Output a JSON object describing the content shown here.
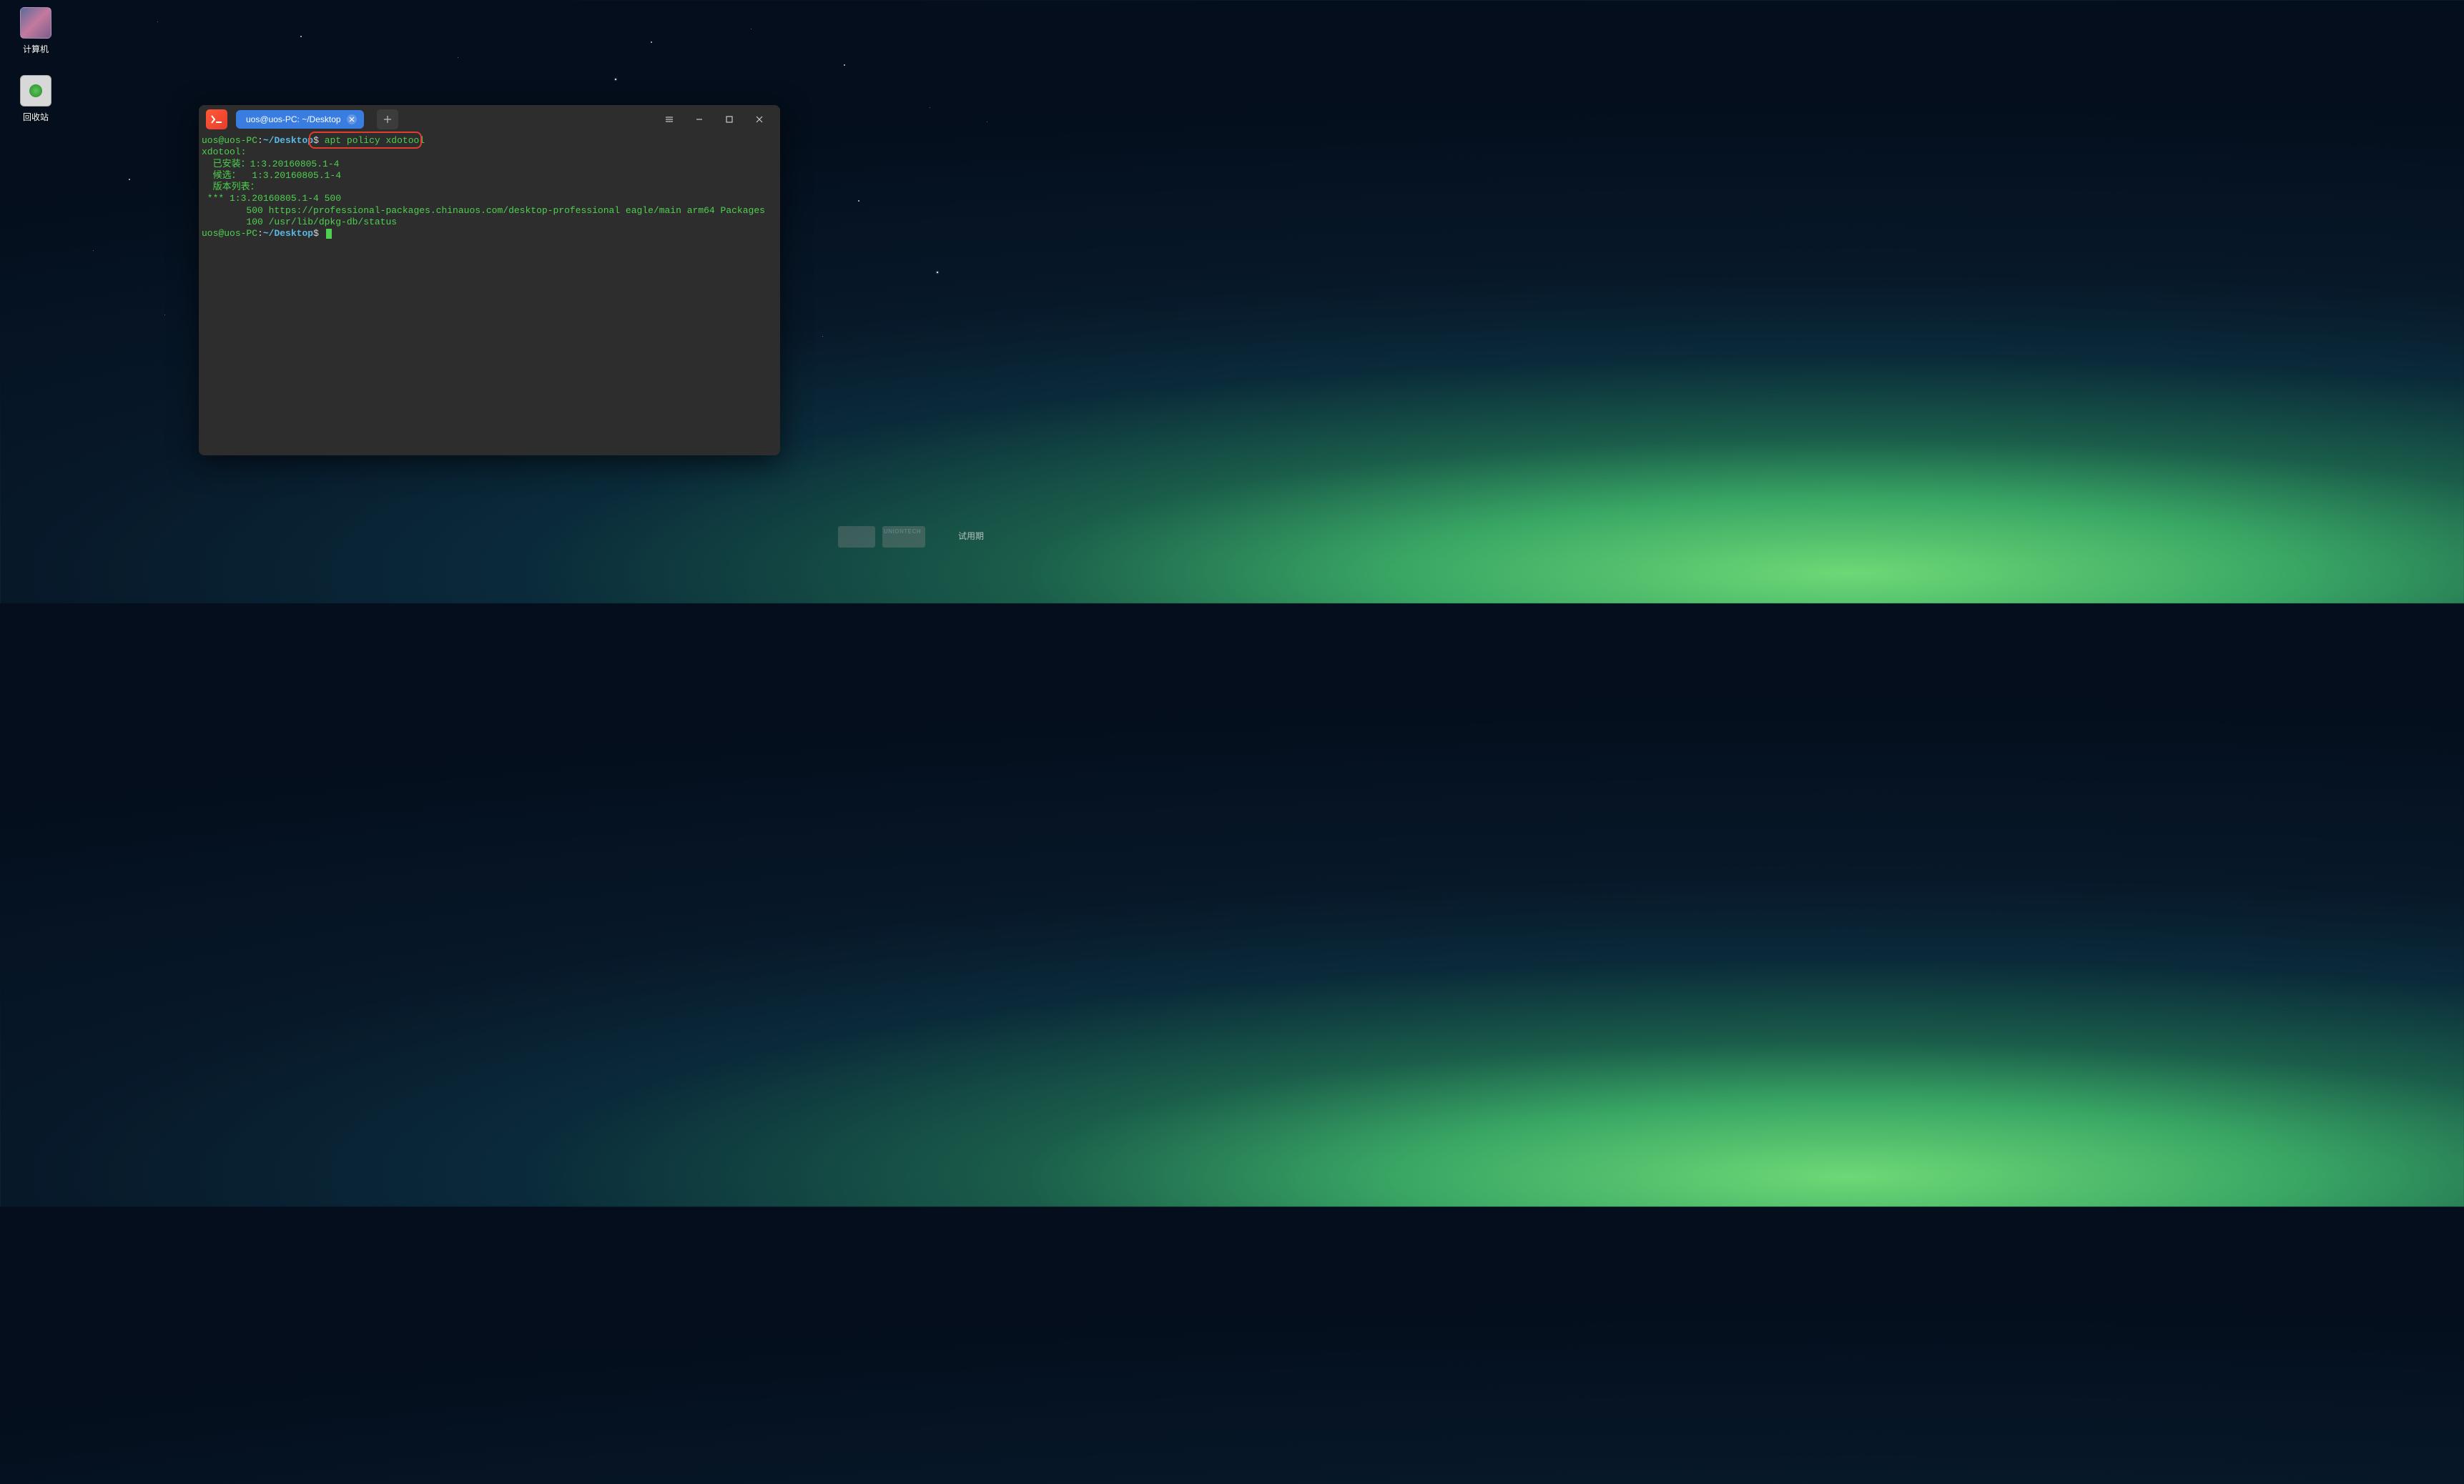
{
  "desktop": {
    "icons": [
      {
        "name": "computer",
        "label": "计算机"
      },
      {
        "name": "trash",
        "label": "回收站"
      }
    ]
  },
  "terminal": {
    "tab_title": "uos@uos-PC: ~/Desktop",
    "prompt": {
      "user": "uos",
      "at": "@",
      "host": "uos-PC",
      "colon": ":",
      "path": "~/Desktop",
      "dollar": "$"
    },
    "command": "apt policy xdotool",
    "output_lines": [
      "xdotool:",
      "  已安装：1:3.20160805.1-4",
      "  候选：  1:3.20160805.1-4",
      "  版本列表：",
      " *** 1:3.20160805.1-4 500",
      "        500 https://professional-packages.chinauos.com/desktop-professional eagle/main arm64 Packages",
      "        100 /usr/lib/dpkg-db/status"
    ]
  },
  "watermark": {
    "brand": "UNIONTECH"
  },
  "trial": "试用期"
}
